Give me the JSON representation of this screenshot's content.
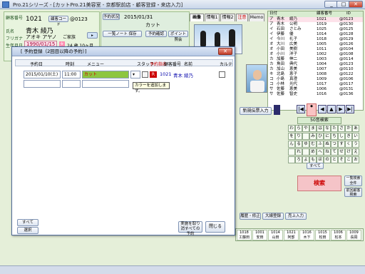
{
  "window": {
    "title": "Pro.21シリーズ - [カットPro.21美容室 - 京都駅前店 - 顧客登録・来店入力]"
  },
  "customer": {
    "labels": [
      "顧客番号",
      "氏名",
      "フリガナ",
      "生年月日"
    ],
    "number": "1021",
    "member_code_label": "顧客コード",
    "member_code": "@0123",
    "name": "青木 綾乃",
    "kana": "アオキ アヤノ",
    "kana_suffix": "ご家族",
    "birthdate": "1990/01/15",
    "age": "24 歳 10ヶ月",
    "sex_mark": "女"
  },
  "visit": {
    "date": "2015/01/31",
    "menu": "カット",
    "buttons": [
      "予約状況",
      "一覧ノート 保存",
      "予約確認",
      "ポイント 照会",
      "一覧ノート 保存",
      "ポイント照会"
    ]
  },
  "tabs": [
    "画像",
    "情報1",
    "情報2",
    "注意",
    "Memo"
  ],
  "right_list": {
    "header": [
      "日付",
      "顧客番号",
      "ID"
    ],
    "rows": [
      [
        "ア",
        "青木",
        "綾乃",
        "1021",
        "@0123"
      ],
      [
        "ア",
        "青木",
        "公明",
        "1019",
        "@0130"
      ],
      [
        "イ",
        "石田",
        "さとみ",
        "1025",
        "@0125"
      ],
      [
        "イ",
        "伊藤",
        "優",
        "1014",
        "@0128"
      ],
      [
        "イ",
        "今川",
        "礼子",
        "1018",
        "@0129"
      ],
      [
        "オ",
        "大川",
        "広美",
        "1005",
        "@0126"
      ],
      [
        "オ",
        "小田",
        "美樹",
        "1011",
        "@0104"
      ],
      [
        "オ",
        "小川",
        "洋子",
        "1002",
        "@0108"
      ],
      [
        "カ",
        "加藤",
        "伸二",
        "1003",
        "@0114"
      ],
      [
        "カ",
        "角田",
        "典代",
        "1004",
        "@0123"
      ],
      [
        "カ",
        "加山",
        "恵美",
        "1007",
        "@0110"
      ],
      [
        "キ",
        "北島",
        "恵子",
        "1008",
        "@0122"
      ],
      [
        "コ",
        "小島",
        "真澄",
        "1009",
        "@0106"
      ],
      [
        "コ",
        "小林",
        "光代",
        "1017",
        "@0117"
      ],
      [
        "サ",
        "佐藤",
        "恵美",
        "1006",
        "@0131"
      ],
      [
        "サ",
        "佐藤",
        "智史",
        "1016",
        "@0136"
      ]
    ]
  },
  "kana": {
    "header": "50音検索",
    "keys": [
      "わ",
      "ら",
      "や",
      "ま",
      "は",
      "な",
      "た",
      "さ",
      "か",
      "あ",
      "を",
      "り",
      "",
      "み",
      "ひ",
      "に",
      "ち",
      "し",
      "き",
      "い",
      "ん",
      "る",
      "ゆ",
      "む",
      "ふ",
      "ぬ",
      "つ",
      "す",
      "く",
      "う",
      "",
      "れ",
      "",
      "め",
      "へ",
      "ね",
      "て",
      "せ",
      "け",
      "え",
      "",
      "ろ",
      "よ",
      "も",
      "ほ",
      "の",
      "と",
      "そ",
      "こ",
      "お"
    ],
    "all_label": "すべて"
  },
  "search": {
    "label": "検索",
    "all_customers": "一覧検索 全件",
    "other": "前回顧客検索"
  },
  "new_ticket": "新規伝票入力",
  "bottom_nav": {
    "items": [
      "1018",
      "1001",
      "1014",
      "1021",
      "1016",
      "1015",
      "1006",
      "1009"
    ],
    "names": [
      "工藤田",
      "安田",
      "山田",
      "阿部",
      "木下",
      "松田",
      "松本",
      "長岡"
    ]
  },
  "modal": {
    "title": "[ 予約登録（2回目以降の予約）]",
    "headers": [
      "予約日",
      "時刻",
      "メニュー",
      "スタッフ",
      "予約指名",
      "顧客番号",
      "名前",
      "顧客番号",
      "カルテ"
    ],
    "row": {
      "date": "2015/01/10(土)",
      "time": "11:00",
      "menu": "カット",
      "staff_mark": "R",
      "number": "1021",
      "name": "青木 綾乃"
    },
    "tooltip": "カラーを追加します。",
    "buttons": {
      "all": "すべて",
      "clear": "選択",
      "cancel": "実施を取り消すべての予約",
      "close": "閉じる"
    }
  },
  "bottom_btns": [
    "履歴・修正",
    "大線登録",
    "売上入力"
  ],
  "status": {
    "point": "ポイント",
    "value": "0",
    "unit": "円"
  }
}
